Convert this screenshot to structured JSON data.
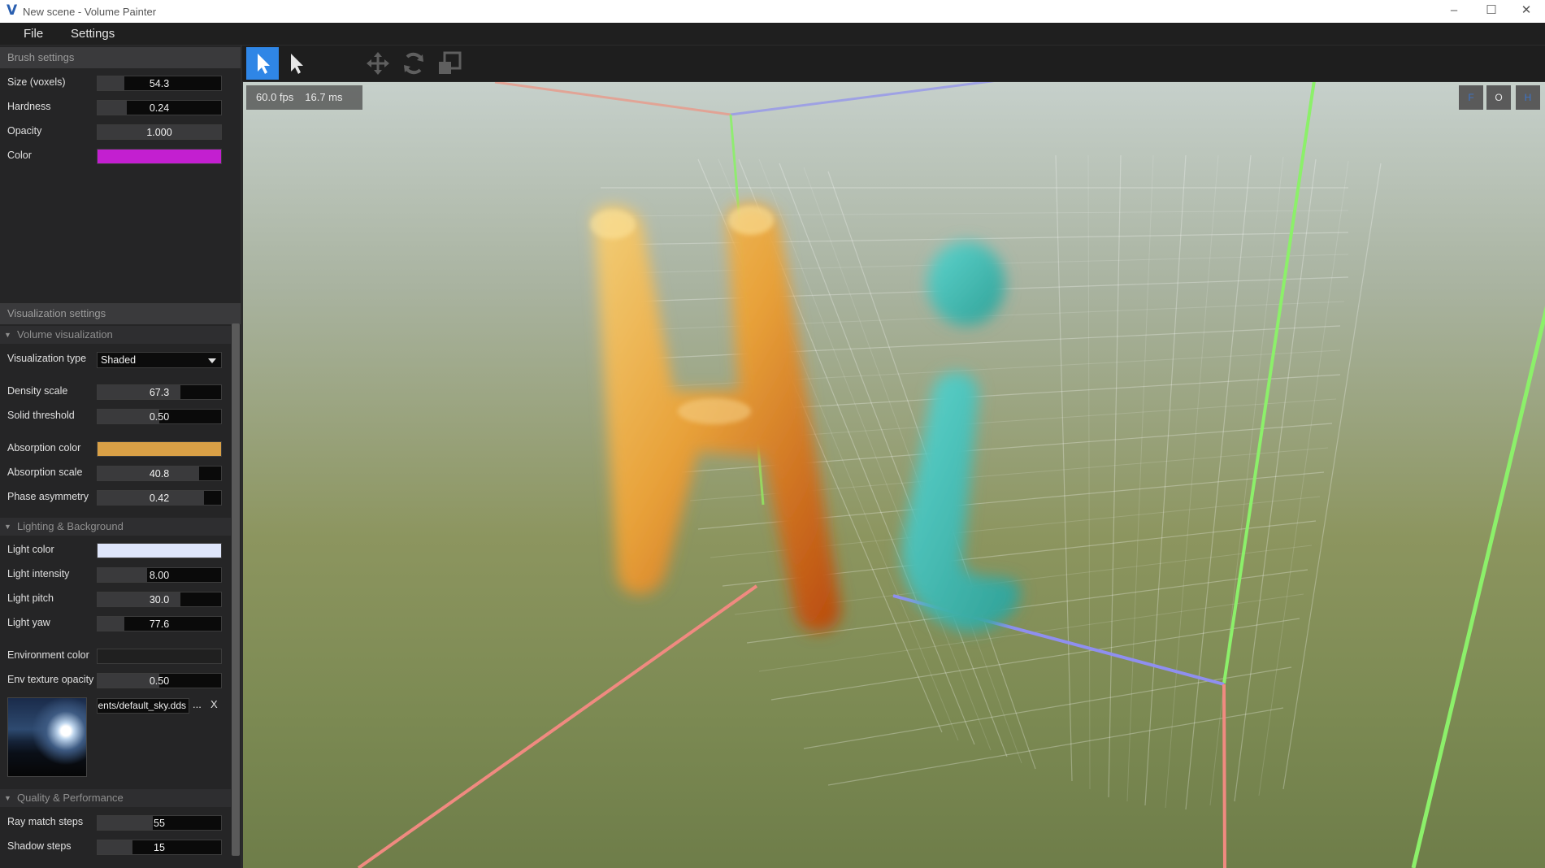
{
  "window": {
    "logo": "V",
    "title": "New scene - Volume Painter"
  },
  "menu": {
    "file": "File",
    "settings": "Settings"
  },
  "brush": {
    "header": "Brush settings",
    "size": {
      "label": "Size (voxels)",
      "value": "54.3",
      "fill": 0.22
    },
    "hardness": {
      "label": "Hardness",
      "value": "0.24",
      "fill": 0.24
    },
    "opacity": {
      "label": "Opacity",
      "value": "1.000",
      "fill": 1.0
    },
    "color": {
      "label": "Color",
      "hex": "#c31fd0"
    }
  },
  "visualization": {
    "header": "Visualization settings",
    "volume": {
      "title": "Volume visualization",
      "type": {
        "label": "Visualization type",
        "value": "Shaded"
      },
      "density_scale": {
        "label": "Density scale",
        "value": "67.3",
        "fill": 0.67
      },
      "solid_threshold": {
        "label": "Solid threshold",
        "value": "0.50",
        "fill": 0.5
      },
      "absorption_color": {
        "label": "Absorption color",
        "hex": "#d9a046"
      },
      "absorption_scale": {
        "label": "Absorption scale",
        "value": "40.8",
        "fill": 0.82
      },
      "phase_asymmetry": {
        "label": "Phase asymmetry",
        "value": "0.42",
        "fill": 0.86
      }
    },
    "lighting": {
      "title": "Lighting & Background",
      "light_color": {
        "label": "Light color",
        "hex": "#dfe6fb"
      },
      "light_intensity": {
        "label": "Light intensity",
        "value": "8.00",
        "fill": 0.4
      },
      "light_pitch": {
        "label": "Light pitch",
        "value": "30.0",
        "fill": 0.67
      },
      "light_yaw": {
        "label": "Light yaw",
        "value": "77.6",
        "fill": 0.22
      },
      "environment_color": {
        "label": "Environment color",
        "hex": "#202020"
      },
      "env_texture_opacity": {
        "label": "Env texture opacity",
        "value": "0.50",
        "fill": 0.5
      },
      "env_texture": {
        "path": "ents/default_sky.dds",
        "browse": "...",
        "clear": "X"
      }
    },
    "quality": {
      "title": "Quality & Performance",
      "ray_march_steps": {
        "label": "Ray match steps",
        "value": "55",
        "fill": 0.45
      },
      "shadow_steps": {
        "label": "Shadow steps",
        "value": "15",
        "fill": 0.28
      }
    }
  },
  "toolbar": {
    "tools": [
      "select-tool-active",
      "select-tool",
      "move-tool",
      "rotate-tool",
      "scale-tool"
    ],
    "accent": "#2f86e6"
  },
  "viewport": {
    "fps": "60.0 fps",
    "frame_time": "16.7 ms",
    "view_buttons": [
      "F",
      "O",
      "H"
    ]
  }
}
